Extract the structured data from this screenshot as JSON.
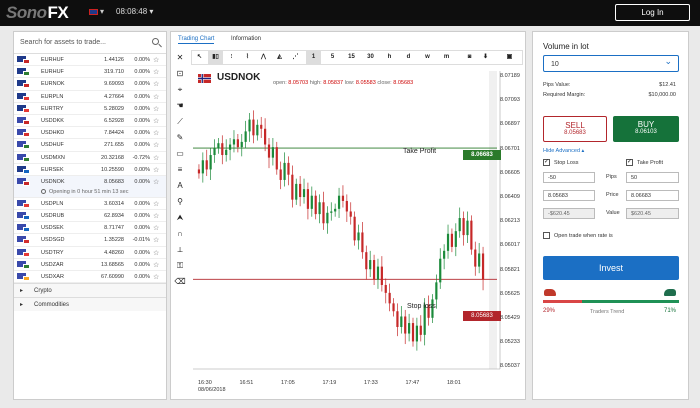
{
  "topbar": {
    "logo_a": "Sono",
    "logo_b": "FX",
    "lang": "▾",
    "clock": "08:08:48 ▾",
    "login_label": "Log In"
  },
  "search": {
    "placeholder": "Search for assets to trade..."
  },
  "assets": [
    {
      "symbol": "EURHUF",
      "price": "1.44126",
      "change": "0.00%",
      "flag_a": "#1f3a8a",
      "flag_b": "#c62828"
    },
    {
      "symbol": "EURHUF",
      "price": "319.710",
      "change": "0.00%",
      "flag_a": "#1f3a8a",
      "flag_b": "#2e7d32"
    },
    {
      "symbol": "EURNOK",
      "price": "9.69093",
      "change": "0.00%",
      "flag_a": "#1f3a8a",
      "flag_b": "#c62828"
    },
    {
      "symbol": "EURPLN",
      "price": "4.27664",
      "change": "0.00%",
      "flag_a": "#1f3a8a",
      "flag_b": "#e53935"
    },
    {
      "symbol": "EURTRY",
      "price": "5.28029",
      "change": "0.00%",
      "flag_a": "#1f3a8a",
      "flag_b": "#e53935"
    },
    {
      "symbol": "USDDKK",
      "price": "6.52928",
      "change": "0.00%",
      "flag_a": "#3949ab",
      "flag_b": "#c62828"
    },
    {
      "symbol": "USDHKD",
      "price": "7.84424",
      "change": "0.00%",
      "flag_a": "#3949ab",
      "flag_b": "#d32f2f"
    },
    {
      "symbol": "USDHUF",
      "price": "271.655",
      "change": "0.00%",
      "flag_a": "#3949ab",
      "flag_b": "#2e7d32"
    },
    {
      "symbol": "USDMXN",
      "price": "20.32168",
      "change": "-0.72%",
      "flag_a": "#3949ab",
      "flag_b": "#2e7d32"
    },
    {
      "symbol": "EURSEK",
      "price": "10.25590",
      "change": "0.00%",
      "flag_a": "#1f3a8a",
      "flag_b": "#1565c0"
    }
  ],
  "selected_asset": {
    "symbol": "USDNOK",
    "price": "8.05683",
    "change": "0.00%",
    "opening": "Opening in 0 hour 51 min 13 sec",
    "flag_a": "#3949ab",
    "flag_b": "#c62828"
  },
  "assets2": [
    {
      "symbol": "USDPLN",
      "price": "3.60314",
      "change": "0.00%",
      "flag_a": "#3949ab",
      "flag_b": "#e53935"
    },
    {
      "symbol": "USDRUB",
      "price": "62.8934",
      "change": "0.00%",
      "flag_a": "#3949ab",
      "flag_b": "#1565c0"
    },
    {
      "symbol": "USDSEK",
      "price": "8.71747",
      "change": "0.00%",
      "flag_a": "#3949ab",
      "flag_b": "#1565c0"
    },
    {
      "symbol": "USDSGD",
      "price": "1.35228",
      "change": "-0.01%",
      "flag_a": "#3949ab",
      "flag_b": "#d32f2f"
    },
    {
      "symbol": "USDTRY",
      "price": "4.48260",
      "change": "0.00%",
      "flag_a": "#3949ab",
      "flag_b": "#e53935"
    },
    {
      "symbol": "USDZAR",
      "price": "13.68565",
      "change": "0.00%",
      "flag_a": "#3949ab",
      "flag_b": "#2e7d32"
    },
    {
      "symbol": "USDXAR",
      "price": "67.60990",
      "change": "0.00%",
      "flag_a": "#3949ab",
      "flag_b": "#f9a825"
    }
  ],
  "categories": [
    "Crypto",
    "Commodities"
  ],
  "tabs": {
    "trading_chart": "Trading Chart",
    "information": "Information"
  },
  "toolbar": [
    "1",
    "5",
    "15",
    "30",
    "h",
    "d",
    "w",
    "m"
  ],
  "chart": {
    "symbol": "USDNOK",
    "ohlc_labels": {
      "open": "open:",
      "high": "high:",
      "low": "low:",
      "close": "close:"
    },
    "ohlc_values": {
      "open": "8.05703",
      "high": "8.05837",
      "low": "8.05583",
      "close": "8.05683"
    },
    "take_profit_label": "Take Profit",
    "take_profit_value": "8.06683",
    "stop_loss_label": "Stop loss",
    "stop_loss_value": "8.05683",
    "date_label": "08/06/2018",
    "colors": {
      "up": "#1b8a3a",
      "down": "#c62828",
      "tp": "#2a7a2a",
      "sl": "#b2262c"
    }
  },
  "chart_data": {
    "type": "candlestick",
    "y_ticks": [
      "8.07189",
      "8.07093",
      "8.06897",
      "8.06701",
      "8.06605",
      "8.06409",
      "8.06213",
      "8.06017",
      "8.05821",
      "8.05625",
      "8.05429",
      "8.05233",
      "8.05037"
    ],
    "x_ticks": [
      "16:30",
      "16:51",
      "17:05",
      "17:19",
      "17:33",
      "17:47",
      "18:01"
    ],
    "ylim": [
      8.05,
      8.0727
    ],
    "take_profit": 8.06683,
    "stop_loss": 8.05683,
    "closes": [
      8.0649,
      8.0659,
      8.0652,
      8.0663,
      8.0668,
      8.0672,
      8.0663,
      8.0667,
      8.0671,
      8.0675,
      8.0669,
      8.0673,
      8.0681,
      8.069,
      8.0678,
      8.0686,
      8.0683,
      8.0671,
      8.0661,
      8.0669,
      8.0652,
      8.0644,
      8.0657,
      8.0648,
      8.0629,
      8.0641,
      8.0631,
      8.0637,
      8.0622,
      8.0632,
      8.0618,
      8.0627,
      8.0611,
      8.0619,
      8.062,
      8.0622,
      8.0632,
      8.0628,
      8.062,
      8.0616,
      8.0598,
      8.0604,
      8.0589,
      8.0576,
      8.0583,
      8.0568,
      8.0578,
      8.0564,
      8.0558,
      8.055,
      8.0544,
      8.0532,
      8.054,
      8.0527,
      8.0535,
      8.0521,
      8.0533,
      8.0526,
      8.0549,
      8.0539,
      8.0553,
      8.0566,
      8.0584,
      8.059,
      8.0603,
      8.0593,
      8.0605,
      8.0615,
      8.0602,
      8.0613,
      8.0591,
      8.0578,
      8.0588,
      8.0568
    ]
  },
  "trade": {
    "volume_label": "Volume in lot",
    "volume_value": "10",
    "pips_value_label": "Pips Value:",
    "pips_value": "$12.41",
    "margin_label": "Required Margin:",
    "margin_value": "$10,000.00",
    "sell_label": "SELL",
    "sell_price": "8.05683",
    "buy_label": "BUY",
    "buy_price": "8.06103",
    "hide_advanced": "Hide Advanced ▴",
    "stop_loss_label": "Stop Loss",
    "take_profit_label": "Take Profit",
    "pips_label": "Pips",
    "price_label": "Price",
    "value_label": "Value",
    "sl_pips": "-50",
    "tp_pips": "50",
    "sl_price": "8.05683",
    "tp_price": "8.06683",
    "sl_value": "-$620.45",
    "tp_value": "$620.45",
    "open_when_label": "Open trade when rate is",
    "invest_label": "Invest",
    "traders_trend_label": "Traders Trend",
    "bear_pct": "29%",
    "bull_pct": "71%",
    "bear_fraction": 0.29
  }
}
